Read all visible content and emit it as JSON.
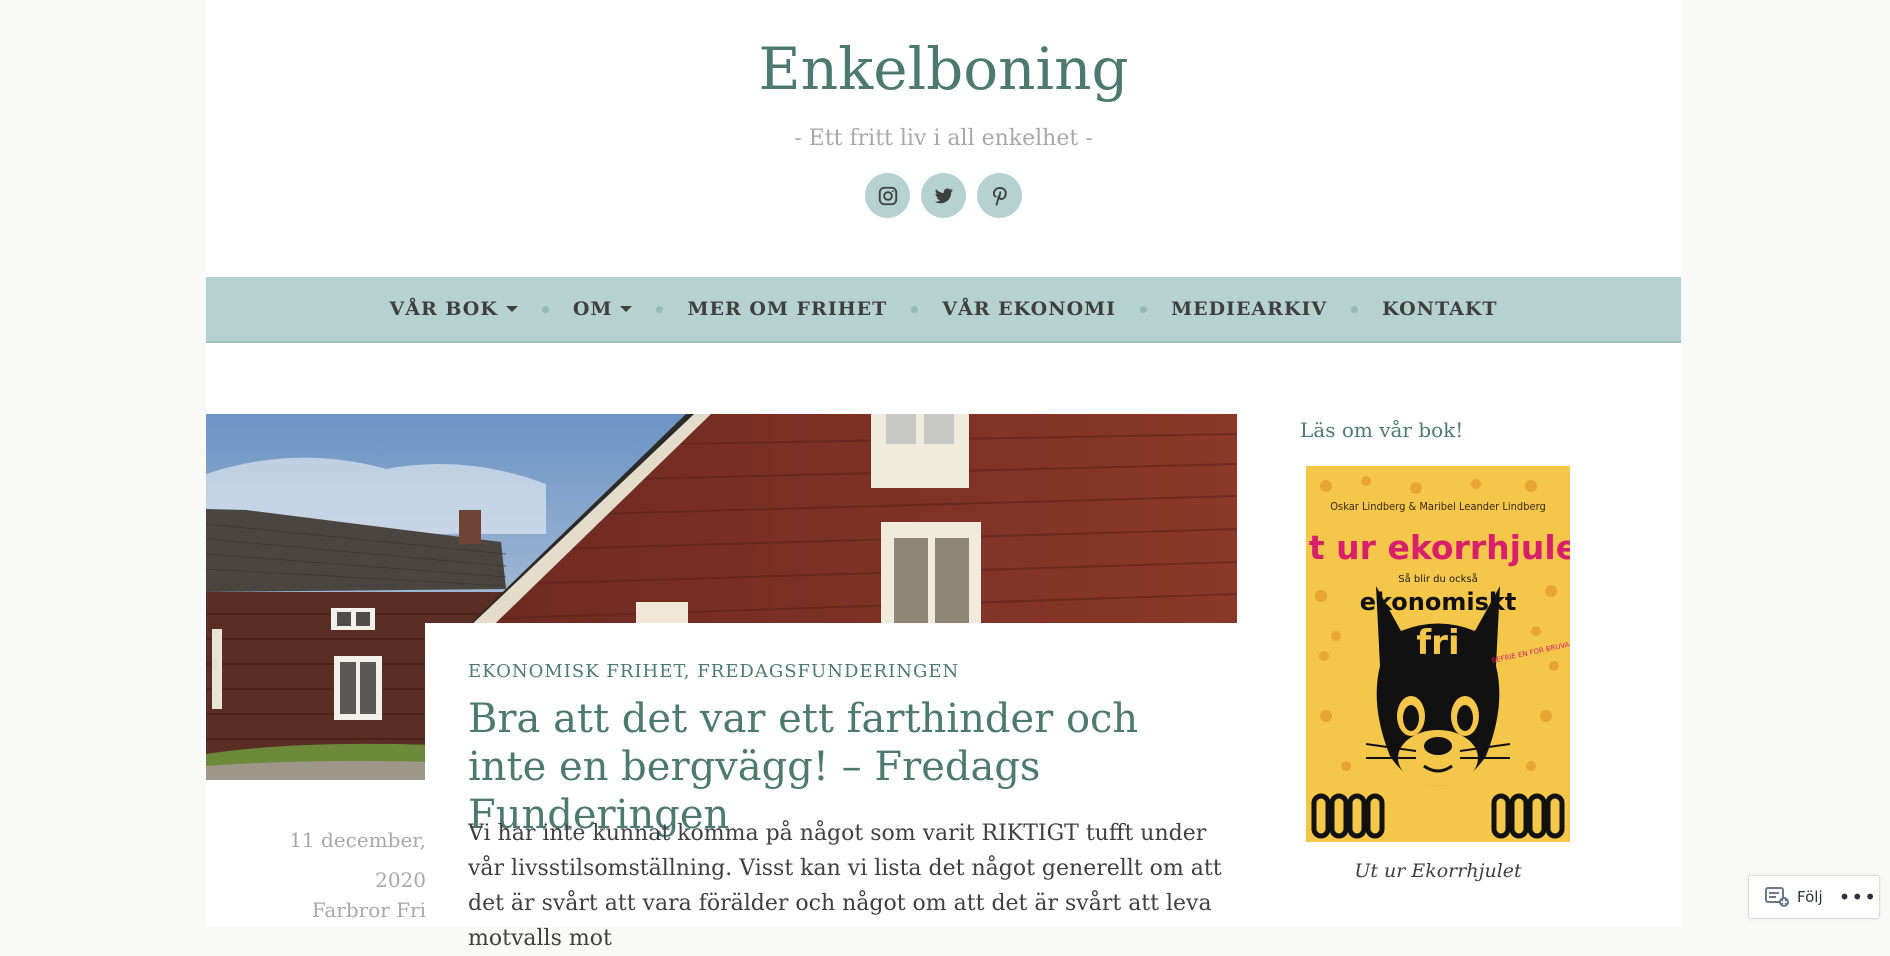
{
  "site": {
    "title": "Enkelboning",
    "tagline": "- Ett fritt liv i all enkelhet -"
  },
  "social": [
    "instagram-icon",
    "twitter-icon",
    "pinterest-icon"
  ],
  "nav": {
    "items": [
      {
        "label": "VÅR BOK",
        "dropdown": true
      },
      {
        "label": "OM",
        "dropdown": true
      },
      {
        "label": "MER OM FRIHET",
        "dropdown": false
      },
      {
        "label": "VÅR EKONOMI",
        "dropdown": false
      },
      {
        "label": "MEDIEARKIV",
        "dropdown": false
      },
      {
        "label": "KONTAKT",
        "dropdown": false
      }
    ]
  },
  "post": {
    "categories": [
      "EKONOMISK FRIHET",
      "FREDAGSFUNDERINGEN"
    ],
    "category_separator": ",",
    "title": "Bra att det var ett farthinder och inte en bergvägg! – Fredags Funderingen",
    "excerpt": "Vi har inte kunnat komma på något som varit RIKTIGT tufft under vår livsstilsomställning. Visst kan vi lista det något generellt om att det är svårt att vara förälder och något om att det är svårt att leva motvalls mot",
    "date_line1": "11 december,",
    "date_line2": "2020",
    "author": "Farbror Fri"
  },
  "sidebar": {
    "widget_title": "Läs om vår bok!",
    "book": {
      "authors": "Oskar Lindberg & Maribel Leander Lindberg",
      "title": "Ut ur ekorrhjulet",
      "subtitle": "Så blir du också",
      "subtitle2": "ekonomiskt",
      "subtitle3": "fri",
      "badge": "BEFRIE EN FOR BRUVA PRISET",
      "caption": "Ut ur Ekorrhjulet"
    }
  },
  "follow": {
    "label": "Följ",
    "more": "•••"
  },
  "colors": {
    "accent": "#4d7a6e",
    "nav_bg": "#b5d2d0",
    "book_bg": "#f4c64a",
    "book_title": "#d81f6c"
  }
}
